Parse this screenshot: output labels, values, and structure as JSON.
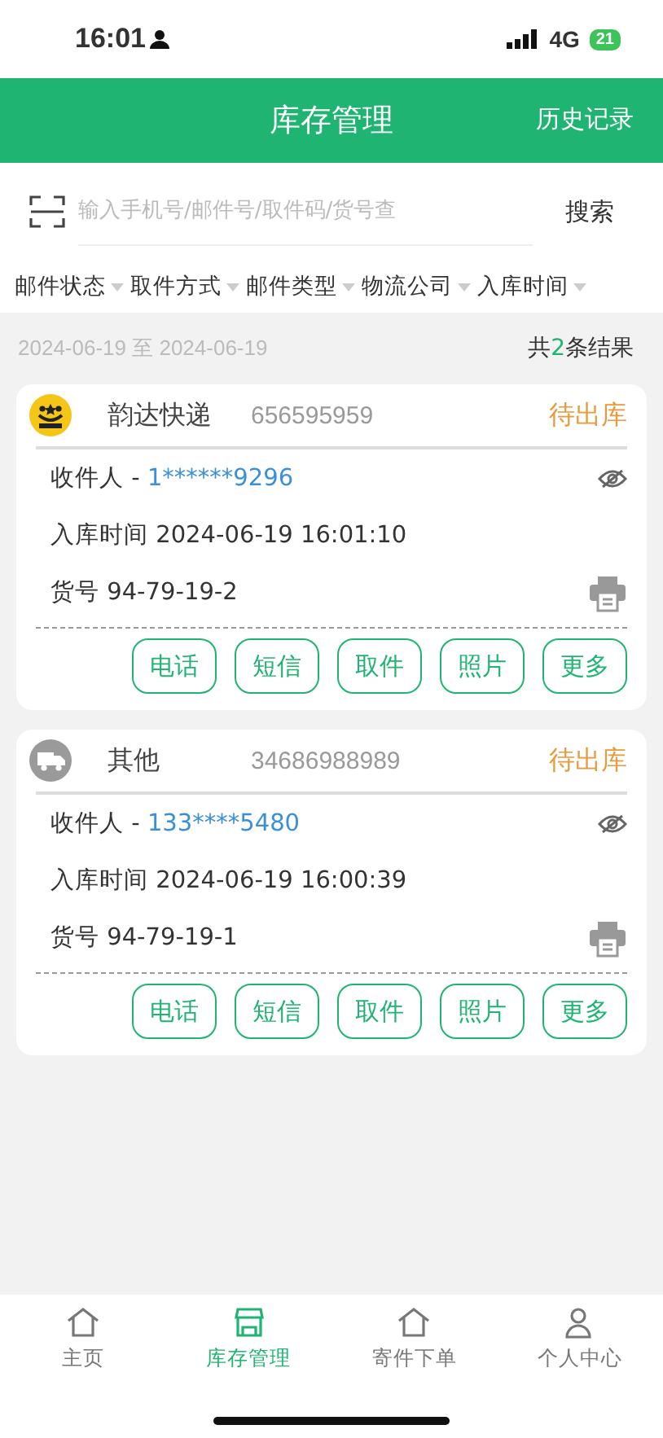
{
  "status_bar": {
    "time": "16:01",
    "network": "4G",
    "battery": "21"
  },
  "header": {
    "title": "库存管理",
    "action": "历史记录"
  },
  "search": {
    "placeholder": "输入手机号/邮件号/取件码/货号查",
    "button": "搜索"
  },
  "filters": [
    "邮件状态",
    "取件方式",
    "邮件类型",
    "物流公司",
    "入库时间"
  ],
  "summary": {
    "date_range": "2024-06-19 至 2024-06-19",
    "prefix": "共",
    "count": "2",
    "suffix": "条结果"
  },
  "parcels": [
    {
      "company": "韵达快递",
      "tracking": "656595959",
      "status": "待出库",
      "recipient_label": "收件人 - ",
      "recipient": "1******9296",
      "time": "入库时间 2024-06-19 16:01:10",
      "code": "货号 94-79-19-2",
      "actions": [
        "电话",
        "短信",
        "取件",
        "照片",
        "更多"
      ]
    },
    {
      "company": "其他",
      "tracking": "34686988989",
      "status": "待出库",
      "recipient_label": "收件人 - ",
      "recipient": "133****5480",
      "time": "入库时间 2024-06-19 16:00:39",
      "code": "货号 94-79-19-1",
      "actions": [
        "电话",
        "短信",
        "取件",
        "照片",
        "更多"
      ]
    }
  ],
  "tab_bar": [
    {
      "label": "主页",
      "selected": false
    },
    {
      "label": "库存管理",
      "selected": true
    },
    {
      "label": "寄件下单",
      "selected": false
    },
    {
      "label": "个人中心",
      "selected": false
    }
  ]
}
